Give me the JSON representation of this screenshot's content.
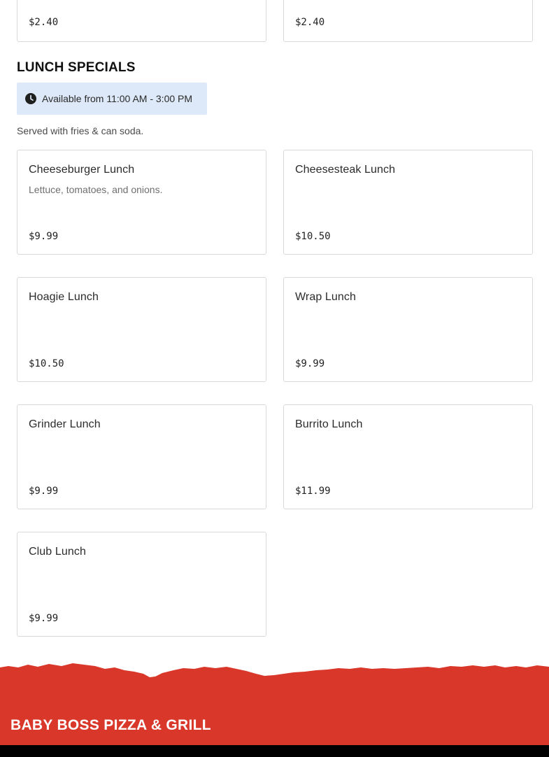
{
  "previous_section": {
    "items": [
      {
        "price": "$2.40"
      },
      {
        "price": "$2.40"
      }
    ]
  },
  "lunch_specials": {
    "title": "LUNCH SPECIALS",
    "availability": "Available from 11:00 AM - 3:00 PM",
    "availability_icon": "clock-icon",
    "note": "Served with fries & can soda.",
    "items": [
      {
        "name": "Cheeseburger Lunch",
        "description": "Lettuce, tomatoes, and onions.",
        "price": "$9.99"
      },
      {
        "name": "Cheesesteak Lunch",
        "description": "",
        "price": "$10.50"
      },
      {
        "name": "Hoagie Lunch",
        "description": "",
        "price": "$10.50"
      },
      {
        "name": "Wrap Lunch",
        "description": "",
        "price": "$9.99"
      },
      {
        "name": "Grinder Lunch",
        "description": "",
        "price": "$9.99"
      },
      {
        "name": "Burrito Lunch",
        "description": "",
        "price": "$11.99"
      },
      {
        "name": "Club Lunch",
        "description": "",
        "price": "$9.99"
      }
    ]
  },
  "footer": {
    "brand": "BABY BOSS PIZZA & GRILL"
  },
  "colors": {
    "footer_red": "#d9372a",
    "availability_bg": "#dde9f8",
    "card_border": "#d9d9d9"
  }
}
